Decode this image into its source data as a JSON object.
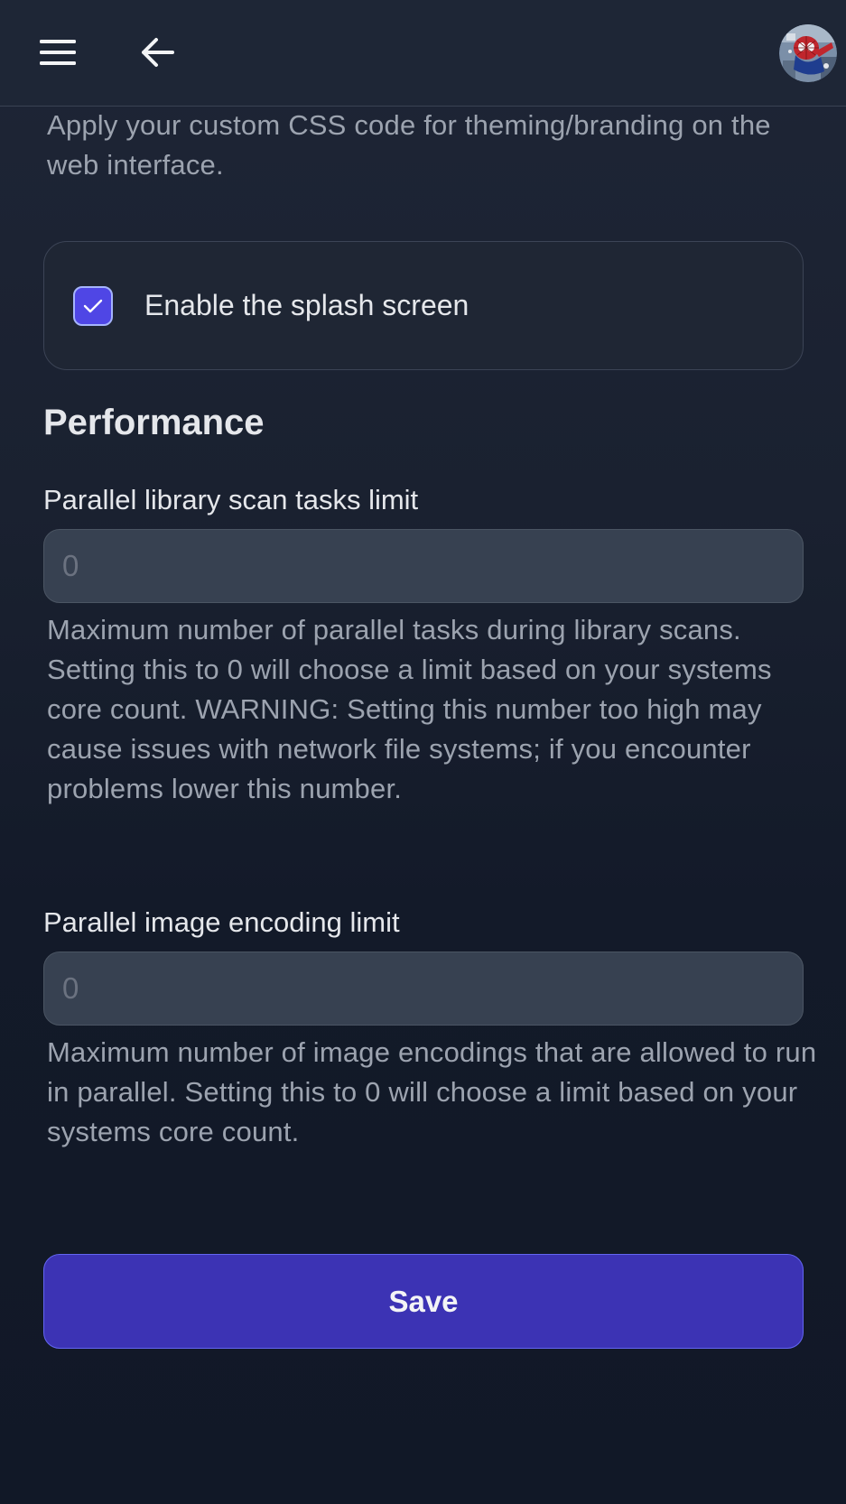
{
  "header": {
    "menu_icon": "hamburger-menu-icon",
    "back_icon": "arrow-left-icon",
    "avatar_alt": "user-avatar"
  },
  "custom_css": {
    "description": "Apply your custom CSS code for theming/branding on the web interface."
  },
  "splash": {
    "label": "Enable the splash screen",
    "checked": true
  },
  "performance": {
    "title": "Performance",
    "scan_limit": {
      "label": "Parallel library scan tasks limit",
      "placeholder": "0",
      "value": "",
      "help": "Maximum number of parallel tasks during library scans. Setting this to 0 will choose a limit based on your systems core count. WARNING: Setting this number too high may cause issues with network file systems; if you encounter problems lower this number."
    },
    "encoding_limit": {
      "label": "Parallel image encoding limit",
      "placeholder": "0",
      "value": "",
      "help": "Maximum number of image encodings that are allowed to run in parallel. Setting this to 0 will choose a limit based on your systems core count."
    }
  },
  "actions": {
    "save_label": "Save"
  },
  "colors": {
    "background": "#111827",
    "accent": "#4f46e5",
    "save_button": "#3c33b4",
    "input_bg": "#374151"
  }
}
